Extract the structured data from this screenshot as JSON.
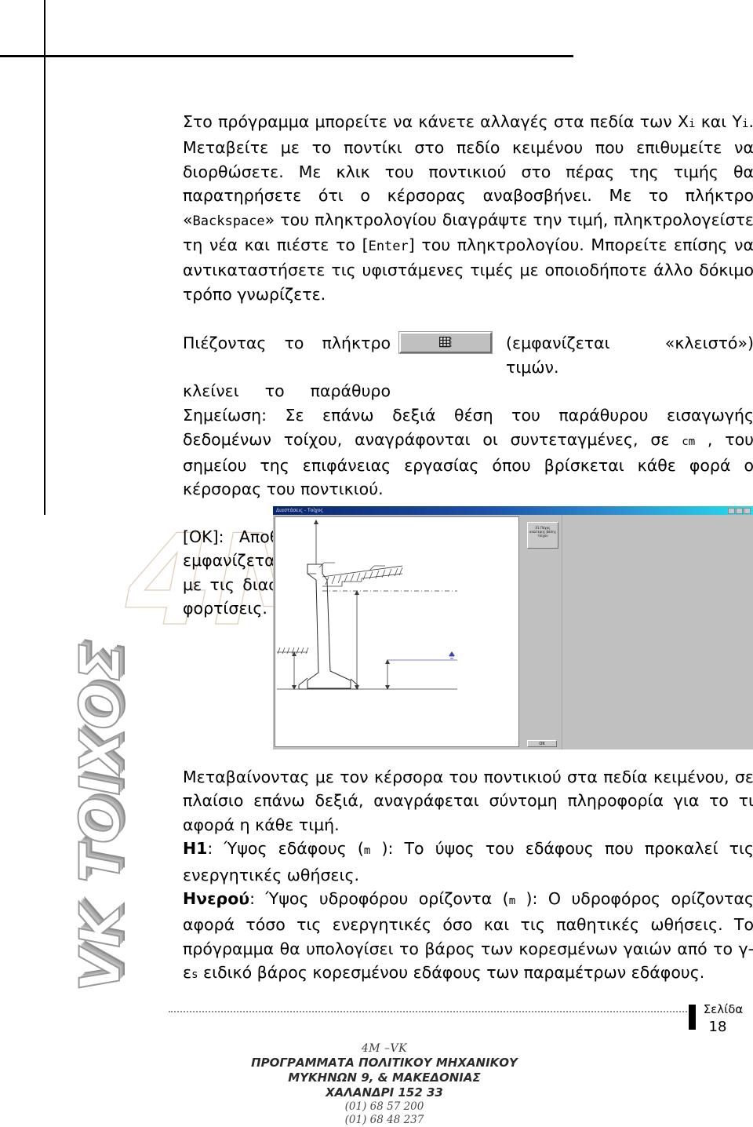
{
  "document": {
    "page_label": "Σελίδα",
    "page_number": "18"
  },
  "body": {
    "p1_a": "Στο πρόγραμμα μπορείτε να κάνετε αλλαγές στα πεδία των Χ",
    "p1_sub1": "i",
    "p1_b": " και Υ",
    "p1_sub2": "i",
    "p1_c": ". Μεταβείτε με το ποντίκι στο πεδίο κειμένου που επιθυμείτε να διορθώσετε. Με κλικ του ποντικιού στο πέρας της τιμής θα παρατηρήσετε ότι ο κέρσορας αναβοσβήνει. Με το πλήκτρο «",
    "p1_kbd1": "Backspace",
    "p1_d": "» του πληκτρολογίου διαγράψτε την τιμή, πληκτρολογείστε τη νέα και πιέστε το [",
    "p1_kbd2": "Enter",
    "p1_e": "] του πληκτρολογίου. Μπορείτε επίσης να αντικαταστήσετε τις υφιστάμενες τιμές με οποιοδήποτε άλλο δόκιμο τρόπο γνωρίζετε.",
    "p2_left_line1": "Πιέζοντας το πλήκτρο",
    "p2_left_line2": "κλείνει το παράθυρο",
    "p2_right_a": "(εμφανίζεται",
    "p2_right_b": "«κλειστό»)",
    "p2_right_c": "τιμών.",
    "p2_button_icon": "grid-table-icon",
    "p3_a": "Σημείωση: Σε επάνω δεξιά θέση του παράθυρου εισαγωγής δεδομένων τοίχου, αναγράφονται οι συντεταγμένες, σε ",
    "p3_unit": "cm",
    "p3_b": " , του σημείου της επιφάνειας εργασίας όπου βρίσκεται κάθε φορά ο κέρσορας του ποντικιού.",
    "p4": "[OK]: Αποθηκεύονται τα γεωμετρικά δεδομένα του τοίχου και εμφανίζεται το τρίτο παράθυρο της εισόδου δεδομένων του τοίχου, με τις διαστάσεις που επιλέχθηκαν, όπου εισάγετε στοιχεία για τις φορτίσεις.",
    "p5": "Μεταβαίνοντας με τον κέρσορα του ποντικιού στα πεδία κειμένου, σε πλαίσιο επάνω δεξιά, αναγράφεται σύντομη πληροφορία για το τι αφορά η κάθε τιμή.",
    "p6_label": "H1",
    "p6_a": ": Ύψος εδάφους (",
    "p6_unit": "m",
    "p6_b": " ): Το ύψος του εδάφους που προκαλεί τις ενεργητικές ωθήσεις.",
    "p7_label": "Hνερού",
    "p7_a": ": Ύψος υδροφόρου ορίζοντα (",
    "p7_unit": "m",
    "p7_b": " ): Ο υδροφόρος ορίζοντας αφορά τόσο τις ενεργητικές όσο και τις παθητικές ωθήσεις. Το πρόγραμμα θα υπολογίσει το βάρος των κορεσμένων γαιών από το γ-ε",
    "p7_sub": "s",
    "p7_c": " ειδικό βάρος κορεσμένου εδάφους των παραμέτρων εδάφους."
  },
  "screenshot": {
    "window_title": "Διαστάσεις - Τοίχος",
    "tooltip_text": "Χ1 Πάχος ανώτερης βάσης τοίχου",
    "ok_button": "OK"
  },
  "watermarks": {
    "side_text": "VK ΤΟΙΧΟΣ",
    "big_text": "4M",
    "side_color": "#9a9a9a",
    "big_color": "#e2cfb9"
  },
  "footer": {
    "brand": "4M –VK",
    "line1": "ΠΡΟΓΡΑΜΜΑΤΑ ΠΟΛΙΤΙΚΟΥ ΜΗΧΑΝΙΚΟΥ",
    "line2": "ΜΥΚΗΝΩΝ 9, & ΜΑΚΕΔΟΝΙΑΣ",
    "line3": "ΧΑΛΑΝΔΡΙ 152 33",
    "phone1": "(01) 68 57 200",
    "phone2": "(01) 68 48 237"
  }
}
